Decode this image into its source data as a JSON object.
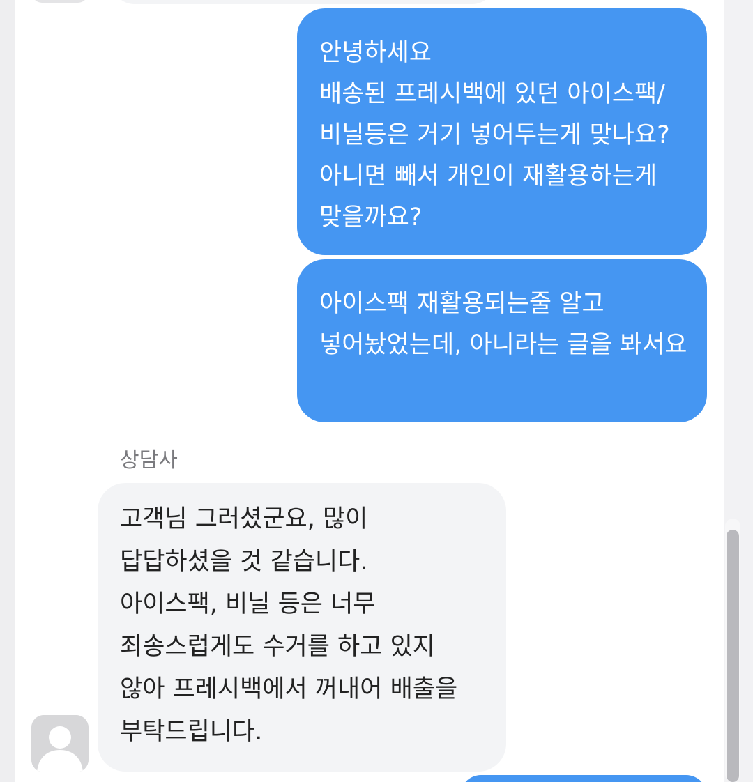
{
  "conversation": {
    "messages": [
      {
        "sender": "user",
        "text": "안녕하세요\n배송된 프레시백에 있던 아이스팩/비닐등은 거기 넣어두는게 맞나요? 아니면 빼서 개인이 재활용하는게 맞을까요?"
      },
      {
        "sender": "user",
        "text": "아이스팩 재활용되는줄 알고 넣어놨었는데, 아니라는 글을 봐서요"
      },
      {
        "sender": "agent",
        "sender_name": "상담사",
        "text": "고객님 그러셨군요, 많이 답답하셨을 것 같습니다.\n아이스팩, 비닐 등은 너무 죄송스럽게도 수거를 하고 있지 않아 프레시백에서 꺼내어 배출을 부탁드립니다."
      }
    ]
  },
  "colors": {
    "user_bubble": "#4596f2",
    "agent_bubble": "#f3f4f6",
    "sender_name": "#7a7a7e"
  },
  "icons": {
    "agent_avatar": "default-user-avatar-icon"
  }
}
